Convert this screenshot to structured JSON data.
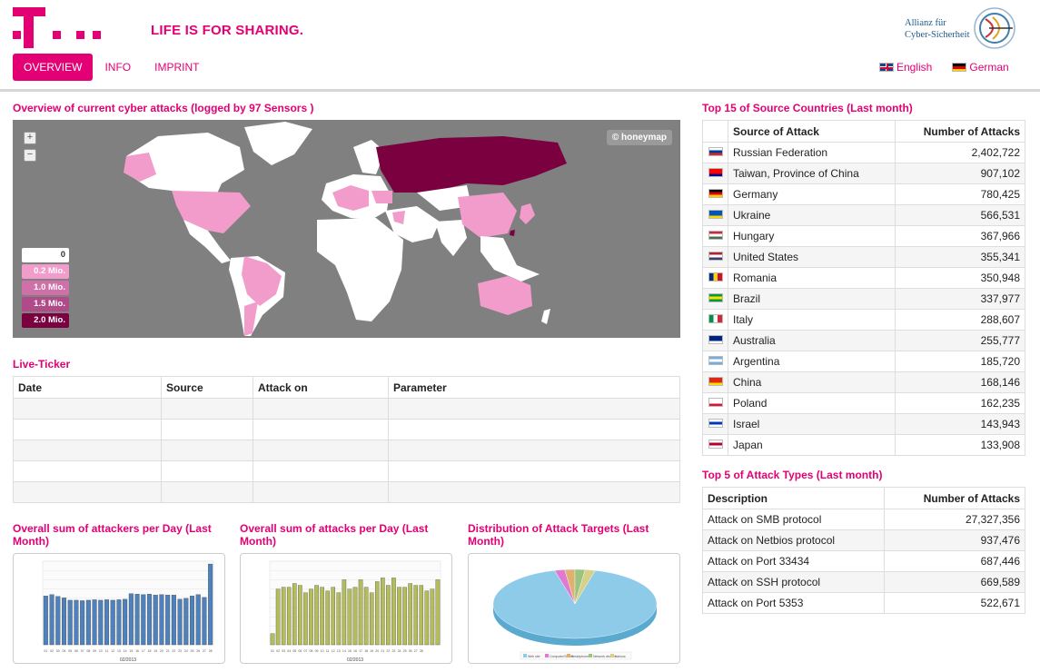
{
  "header": {
    "tagline": "LIFE IS FOR SHARING.",
    "nav": [
      {
        "label": "OVERVIEW",
        "active": true
      },
      {
        "label": "INFO",
        "active": false
      },
      {
        "label": "IMPRINT",
        "active": false
      }
    ],
    "partner_logo": {
      "line1": "Allianz für",
      "line2": "Cyber-Sicherheit"
    },
    "languages": [
      {
        "label": "English",
        "flag": "uk-flag-icon"
      },
      {
        "label": "German",
        "flag": "german-flag-icon"
      }
    ],
    "brand_color": "#e20074"
  },
  "map_section": {
    "title": "Overview of current cyber attacks (logged by 97 Sensors )",
    "credit": "© honeymap",
    "zoom_in": "+",
    "zoom_out": "−",
    "legend": [
      "0",
      "0.2 Mio.",
      "1.0 Mio.",
      "1.5 Mio.",
      "2.0 Mio."
    ]
  },
  "live_ticker": {
    "title": "Live-Ticker",
    "columns": [
      "Date",
      "Source",
      "Attack on",
      "Parameter"
    ]
  },
  "top_countries": {
    "title": "Top 15 of Source Countries (Last month)",
    "columns": [
      "Source of Attack",
      "Number of Attacks"
    ],
    "rows": [
      {
        "country": "Russian Federation",
        "count": "2,402,722"
      },
      {
        "country": "Taiwan, Province of China",
        "count": "907,102"
      },
      {
        "country": "Germany",
        "count": "780,425"
      },
      {
        "country": "Ukraine",
        "count": "566,531"
      },
      {
        "country": "Hungary",
        "count": "367,966"
      },
      {
        "country": "United States",
        "count": "355,341"
      },
      {
        "country": "Romania",
        "count": "350,948"
      },
      {
        "country": "Brazil",
        "count": "337,977"
      },
      {
        "country": "Italy",
        "count": "288,607"
      },
      {
        "country": "Australia",
        "count": "255,777"
      },
      {
        "country": "Argentina",
        "count": "185,720"
      },
      {
        "country": "China",
        "count": "168,146"
      },
      {
        "country": "Poland",
        "count": "162,235"
      },
      {
        "country": "Israel",
        "count": "143,943"
      },
      {
        "country": "Japan",
        "count": "133,908"
      }
    ]
  },
  "attack_types": {
    "title": "Top 5 of Attack Types (Last month)",
    "columns": [
      "Description",
      "Number of Attacks"
    ],
    "rows": [
      {
        "desc": "Attack on SMB protocol",
        "count": "27,327,356"
      },
      {
        "desc": "Attack on Netbios protocol",
        "count": "937,476"
      },
      {
        "desc": "Attack on Port 33434",
        "count": "687,446"
      },
      {
        "desc": "Attack on SSH protocol",
        "count": "669,589"
      },
      {
        "desc": "Attack on Port 5353",
        "count": "522,671"
      }
    ]
  },
  "mini_charts": {
    "attackers_title": "Overall sum of attackers per Day (Last Month)",
    "attacks_title": "Overall sum of attacks per Day (Last Month)",
    "targets_title": "Distribution of Attack Targets (Last Month)",
    "xlabel": "02/2013"
  },
  "chart_data": [
    {
      "type": "bar",
      "title": "Overall sum of attackers per Day (Last Month)",
      "xlabel": "02/2013",
      "categories": [
        "01",
        "02",
        "03",
        "04",
        "05",
        "06",
        "07",
        "08",
        "09",
        "10",
        "11",
        "12",
        "13",
        "14",
        "15",
        "16",
        "17",
        "18",
        "19",
        "20",
        "21",
        "22",
        "23",
        "24",
        "25",
        "26",
        "27",
        "28"
      ],
      "values": [
        1050,
        1080,
        1040,
        1010,
        960,
        960,
        950,
        960,
        970,
        960,
        970,
        960,
        970,
        980,
        1100,
        1090,
        1080,
        1090,
        1070,
        1080,
        1070,
        1070,
        980,
        1000,
        1050,
        1080,
        1020,
        1740
      ],
      "ylim": [
        0,
        1800
      ],
      "color": "#4f81bd"
    },
    {
      "type": "bar",
      "title": "Overall sum of attacks per Day (Last Month)",
      "xlabel": "02/2013",
      "categories": [
        "01",
        "02",
        "03",
        "04",
        "05",
        "06",
        "07",
        "08",
        "09",
        "10",
        "11",
        "12",
        "13",
        "14",
        "15",
        "16",
        "17",
        "18",
        "19",
        "20",
        "21",
        "22",
        "23",
        "24",
        "25",
        "26",
        "27",
        "28"
      ],
      "values": [
        60000,
        300000,
        310000,
        310000,
        330000,
        320000,
        280000,
        300000,
        320000,
        310000,
        290000,
        310000,
        280000,
        350000,
        300000,
        310000,
        350000,
        310000,
        280000,
        340000,
        360000,
        320000,
        360000,
        310000,
        310000,
        330000,
        320000,
        320000,
        290000,
        300000,
        350000
      ],
      "ylim": [
        0,
        450000
      ],
      "color": "#b5bd5a"
    },
    {
      "type": "pie",
      "title": "Distribution of Attack Targets (Last Month)",
      "series": [
        {
          "name": "Web site",
          "value": 92
        },
        {
          "name": "Computer/Server",
          "value": 2
        },
        {
          "name": "Smartphone",
          "value": 2
        },
        {
          "name": "Network devices",
          "value": 2
        },
        {
          "name": "Various",
          "value": 2
        }
      ],
      "colors": [
        "#8ecbe8",
        "#e07ad0",
        "#e0b070",
        "#9bc47e",
        "#d7d088"
      ]
    }
  ]
}
